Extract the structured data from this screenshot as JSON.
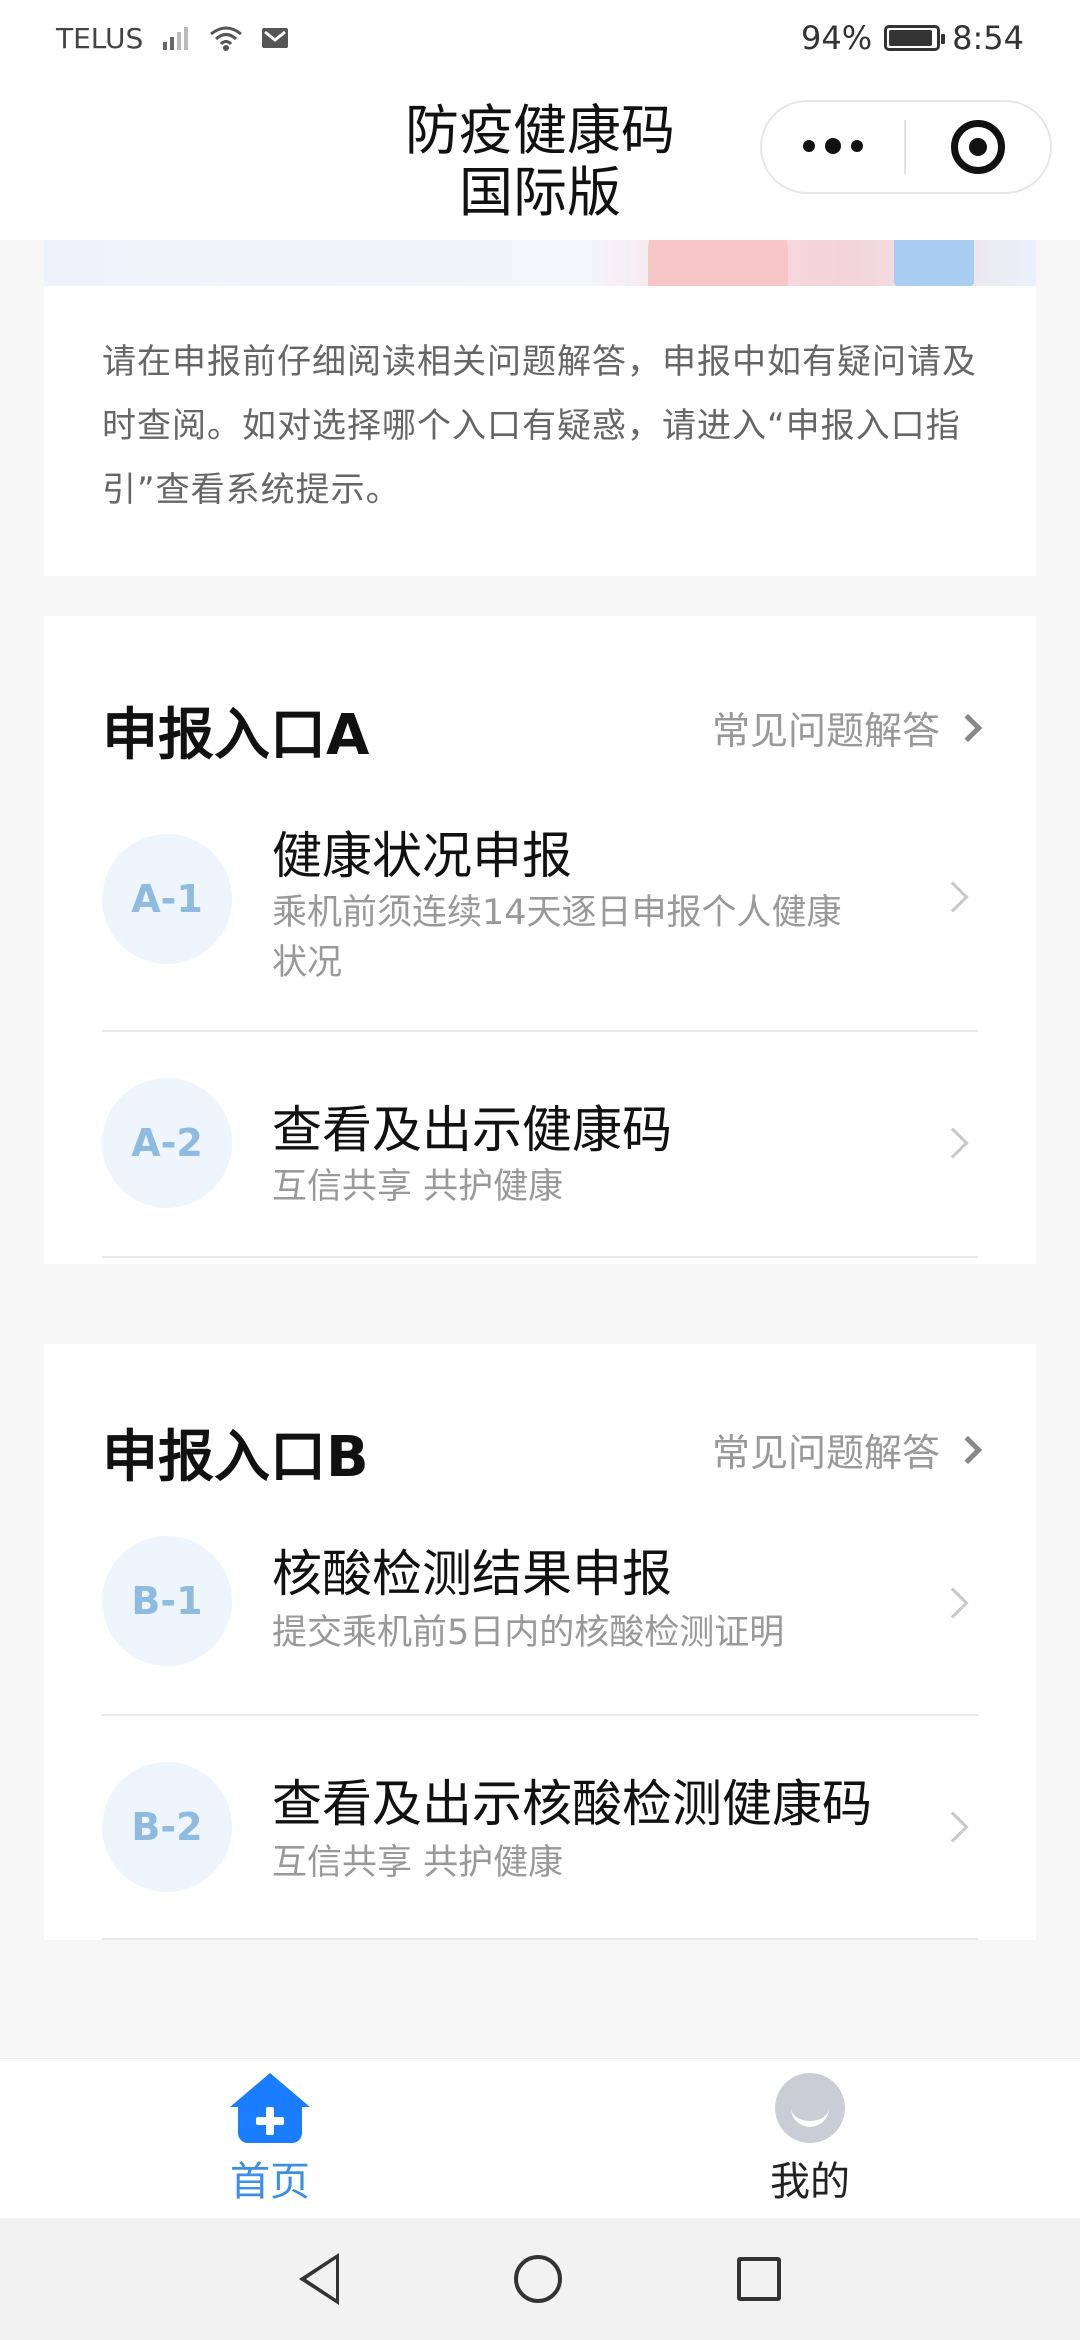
{
  "status_bar": {
    "carrier": "TELUS",
    "battery_percent": "94%",
    "battery_level": 0.94,
    "time": "8:54",
    "icons": [
      "signal-icon",
      "wifi-icon",
      "mail-icon",
      "battery-icon"
    ]
  },
  "nav": {
    "title": "防疫健康码\n国际版",
    "icons": [
      "more-dots-icon",
      "target-icon"
    ]
  },
  "intro": {
    "text": "请在申报前仔细阅读相关问题解答，申报中如有疑问请及时查阅。如对选择哪个入口有疑惑，请进入“申报入口指引”查看系统提示。"
  },
  "section_a": {
    "title": "申报入口A",
    "faq": "常见问题解答",
    "items": [
      {
        "badge": "A-1",
        "title": "健康状况申报",
        "desc": "乘机前须连续14天逐日申报个人健康状况"
      },
      {
        "badge": "A-2",
        "title": "查看及出示健康码",
        "desc": "互信共享 共护健康"
      }
    ]
  },
  "section_b": {
    "title": "申报入口B",
    "faq": "常见问题解答",
    "items": [
      {
        "badge": "B-1",
        "title": "核酸检测结果申报",
        "desc": "提交乘机前5日内的核酸检测证明"
      },
      {
        "badge": "B-2",
        "title": "查看及出示核酸检测健康码",
        "desc": "互信共享 共护健康"
      }
    ]
  },
  "tabs": [
    {
      "label": "首页",
      "icon": "home-plus-icon",
      "active": true
    },
    {
      "label": "我的",
      "icon": "avatar-icon",
      "active": false
    }
  ],
  "colors": {
    "accent": "#1a7dff",
    "tab_active": "#3d8ee6",
    "badge_bg": "#eef5fd",
    "badge_text": "#8fbbe0"
  }
}
